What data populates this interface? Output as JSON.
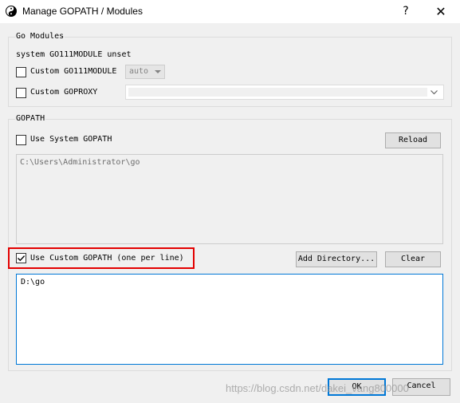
{
  "window": {
    "title": "Manage GOPATH / Modules",
    "help_symbol": "?",
    "close_symbol": "✕"
  },
  "go_modules": {
    "group_title": "Go Modules",
    "status_text": "system GO111MODULE unset",
    "custom_go111module": {
      "label": "Custom GO111MODULE",
      "checked": false,
      "value": "auto"
    },
    "custom_goproxy": {
      "label": "Custom GOPROXY",
      "checked": false,
      "value": ""
    }
  },
  "gopath": {
    "group_title": "GOPATH",
    "use_system": {
      "label": "Use System GOPATH",
      "checked": false
    },
    "reload_label": "Reload",
    "system_path": "C:\\Users\\Administrator\\go",
    "use_custom": {
      "label": "Use Custom GOPATH (one per line)",
      "checked": true
    },
    "add_directory_label": "Add Directory...",
    "clear_label": "Clear",
    "custom_paths": "D:\\go"
  },
  "footer": {
    "ok_label": "OK",
    "cancel_label": "Cancel",
    "watermark": "https://blog.csdn.net/dakei_vang800000"
  },
  "colors": {
    "accent": "#0078d7",
    "highlight": "#e30000",
    "dialog_bg": "#f0f0f0"
  }
}
